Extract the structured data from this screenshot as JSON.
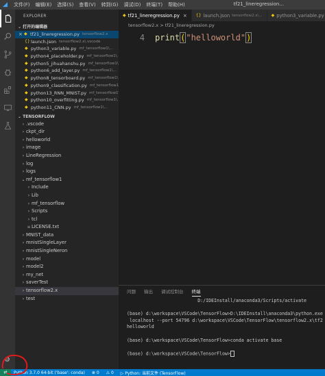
{
  "titlebar": {
    "menu": [
      "文件(F)",
      "编辑(E)",
      "选择(S)",
      "查看(V)",
      "转到(G)",
      "调试(D)",
      "终端(T)",
      "帮助(H)"
    ],
    "title": "tf21_lineregression..."
  },
  "sidebar": {
    "title": "EXPLORER",
    "open_editors_label": "打开的编辑器",
    "open_editors": [
      {
        "name": "tf21_lineregression.py",
        "path": "tensorflow2.x",
        "active": true
      },
      {
        "name": "launch.json",
        "path": "tensorflow2.x\\.vscode"
      },
      {
        "name": "python3_variable.py",
        "path": "mf_tensorflow1\\..."
      },
      {
        "name": "python4_placeholder.py",
        "path": "mf_tensorflow1\\..."
      },
      {
        "name": "python5_jihuahanshu.py",
        "path": "mf_tensorflow1\\..."
      },
      {
        "name": "python6_add_layer.py",
        "path": "mf_tensorflow1\\..."
      },
      {
        "name": "python8_tensorboard.py",
        "path": "mf_tensorflow1\\..."
      },
      {
        "name": "python9_classification.py",
        "path": "mf_tensorflow1\\..."
      },
      {
        "name": "python13_RNN_MNIST.py",
        "path": "mf_tensorflow1\\..."
      },
      {
        "name": "python10_overfitting.py",
        "path": "mf_tensorflow1\\..."
      },
      {
        "name": "python11_CNN.py",
        "path": "mf_tensorflow1\\..."
      }
    ],
    "workspace_label": "TENSORFLOW",
    "tree": [
      {
        "name": ".vscode",
        "type": "folder",
        "level": 0
      },
      {
        "name": "ckpt_dir",
        "type": "folder",
        "level": 0
      },
      {
        "name": "helloworld",
        "type": "folder",
        "level": 0
      },
      {
        "name": "image",
        "type": "folder",
        "level": 0
      },
      {
        "name": "LineRegression",
        "type": "folder",
        "level": 0
      },
      {
        "name": "log",
        "type": "folder",
        "level": 0
      },
      {
        "name": "logs",
        "type": "folder",
        "level": 0
      },
      {
        "name": "mf_tensorflow1",
        "type": "folder-open",
        "level": 0
      },
      {
        "name": "Include",
        "type": "folder",
        "level": 1
      },
      {
        "name": "Lib",
        "type": "folder",
        "level": 1
      },
      {
        "name": "mf_tensorflow",
        "type": "folder",
        "level": 1
      },
      {
        "name": "Scripts",
        "type": "folder",
        "level": 1
      },
      {
        "name": "tcl",
        "type": "folder",
        "level": 1
      },
      {
        "name": "LICENSE.txt",
        "type": "file",
        "level": 1
      },
      {
        "name": "MNIST_data",
        "type": "folder",
        "level": 0
      },
      {
        "name": "mnistSingleLayer",
        "type": "folder",
        "level": 0
      },
      {
        "name": "mnistSingleNeron",
        "type": "folder",
        "level": 0
      },
      {
        "name": "model",
        "type": "folder",
        "level": 0
      },
      {
        "name": "model2",
        "type": "folder",
        "level": 0
      },
      {
        "name": "my_net",
        "type": "folder",
        "level": 0
      },
      {
        "name": "saverTest",
        "type": "folder",
        "level": 0
      },
      {
        "name": "tensorflow2.x",
        "type": "folder",
        "level": 0,
        "selected": true
      },
      {
        "name": "test",
        "type": "folder",
        "level": 0
      }
    ],
    "outline_label": "大纲"
  },
  "tabs": [
    {
      "name": "tf21_lineregression.py",
      "active": true,
      "closable": true
    },
    {
      "name": "launch.json",
      "path": "tensorflow2.x\\..."
    },
    {
      "name": "python3_variable.py"
    }
  ],
  "breadcrumb": "tensorflow2.x > tf21_lineregression.py",
  "editor": {
    "line_number": "4",
    "code_fn": "print",
    "code_open": "(",
    "code_str": "\"helloworld\"",
    "code_close": ")"
  },
  "panel": {
    "tabs": [
      "问题",
      "输出",
      "调试控制台",
      "终端"
    ],
    "active_tab": "终端",
    "terminal_lines": [
      "                          D:/IDEInstall/anaconda3/Scripts/activate",
      "",
      "(base) d:\\workspace\\VSCode\\TensorFlow>D:\\IDEInstall\\anaconda3\\python.exe",
      " localhost --port 54796 d:\\workspace\\VSCode\\TensorFlow\\tensorflow2.x\\tf2",
      "helloworld",
      "",
      "(base) d:\\workspace\\VSCode\\TensorFlow>conda activate base",
      "",
      "(base) d:\\workspace\\VSCode\\TensorFlow>"
    ]
  },
  "statusbar": {
    "python": "Python 3.7.0 64-bit ('base': conda)",
    "errors": "⊗ 0",
    "warnings": "⚠ 0",
    "env": "▷ Python: 当前文件 (TensorFlow)"
  },
  "colors": {
    "accent": "#007acc",
    "annotation": "#e01b1b"
  }
}
